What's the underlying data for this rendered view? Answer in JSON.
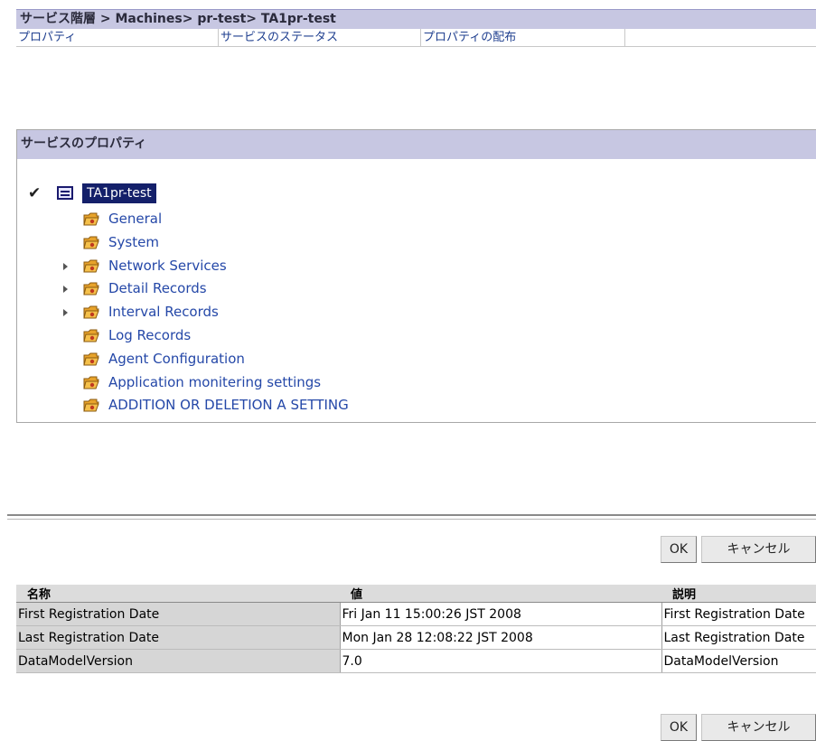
{
  "header": {
    "breadcrumb": "サービス階層 > Machines> pr-test> TA1pr-test",
    "tabs": [
      {
        "label": "プロパティ"
      },
      {
        "label": "サービスのステータス"
      },
      {
        "label": "プロパティの配布"
      }
    ]
  },
  "panel": {
    "title": "サービスのプロパティ",
    "root": {
      "label": "TA1pr-test",
      "check": "✔"
    },
    "items": [
      {
        "label": "General",
        "expandable": false
      },
      {
        "label": "System",
        "expandable": false
      },
      {
        "label": "Network Services",
        "expandable": true
      },
      {
        "label": "Detail Records",
        "expandable": true
      },
      {
        "label": "Interval Records",
        "expandable": true
      },
      {
        "label": "Log Records",
        "expandable": false
      },
      {
        "label": "Agent Configuration",
        "expandable": false
      },
      {
        "label": "Application monitering settings",
        "expandable": false
      },
      {
        "label": "ADDITION OR DELETION A SETTING",
        "expandable": false
      }
    ]
  },
  "actions": {
    "ok_label": "OK",
    "cancel_label": "キャンセル"
  },
  "table": {
    "columns": [
      "名称",
      "値",
      "説明"
    ],
    "rows": [
      {
        "name": "First Registration Date",
        "value": "Fri Jan 11 15:00:26 JST 2008",
        "description": "First Registration Date"
      },
      {
        "name": "Last Registration Date",
        "value": "Mon Jan 28 12:08:22 JST 2008",
        "description": "Last Registration Date"
      },
      {
        "name": "DataModelVersion",
        "value": "7.0",
        "description": "DataModelVersion"
      }
    ]
  },
  "colors": {
    "header_bg": "#c7c7e2",
    "link": "#2548a8",
    "selected_bg": "#14206a"
  }
}
